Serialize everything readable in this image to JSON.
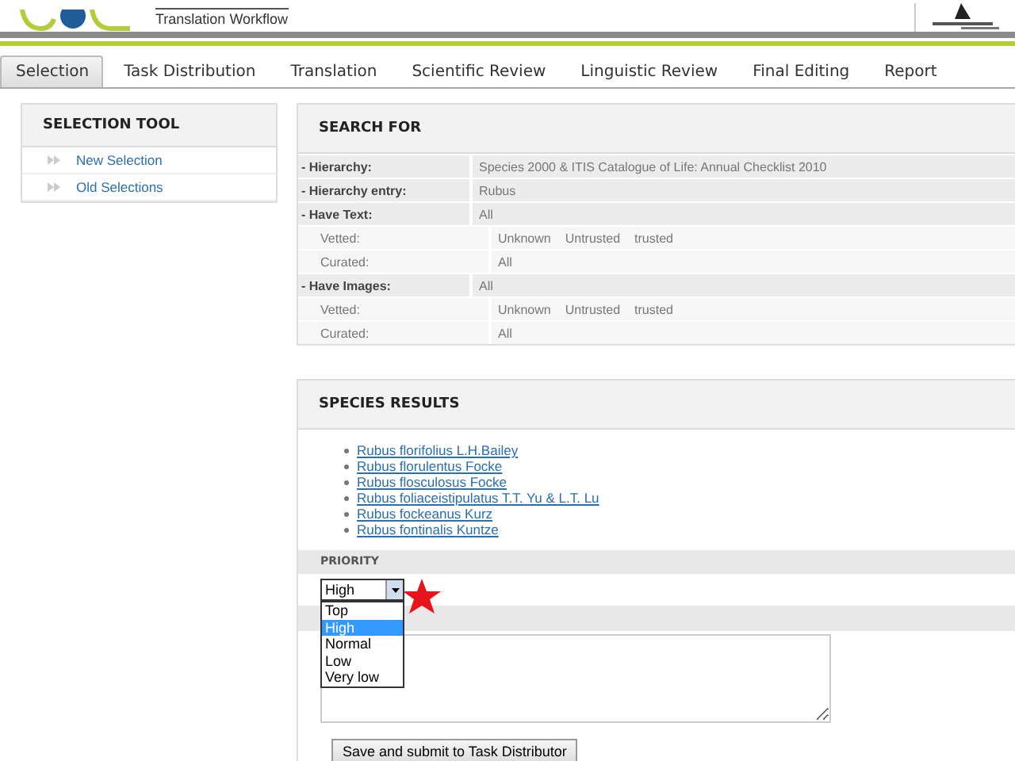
{
  "header": {
    "subtitle": "Translation Workflow"
  },
  "tabs": [
    {
      "label": "Selection",
      "selected": true
    },
    {
      "label": "Task Distribution",
      "selected": false
    },
    {
      "label": "Translation",
      "selected": false
    },
    {
      "label": "Scientific Review",
      "selected": false
    },
    {
      "label": "Linguistic Review",
      "selected": false
    },
    {
      "label": "Final Editing",
      "selected": false
    },
    {
      "label": "Report",
      "selected": false
    }
  ],
  "sidebar": {
    "title": "SELECTION TOOL",
    "items": [
      {
        "label": "New Selection"
      },
      {
        "label": "Old Selections"
      }
    ]
  },
  "search": {
    "title": "SEARCH FOR",
    "rows": [
      {
        "kind": "main",
        "label": "- Hierarchy:",
        "values": [
          "Species 2000 & ITIS Catalogue of Life: Annual Checklist 2010"
        ]
      },
      {
        "kind": "main",
        "label": "- Hierarchy entry:",
        "values": [
          "Rubus"
        ]
      },
      {
        "kind": "main",
        "label": "- Have Text:",
        "values": [
          "All"
        ]
      },
      {
        "kind": "sub",
        "label": "Vetted:",
        "values": [
          "Unknown",
          "Untrusted",
          "trusted"
        ]
      },
      {
        "kind": "sub",
        "label": "Curated:",
        "values": [
          "All"
        ]
      },
      {
        "kind": "main",
        "label": "- Have Images:",
        "values": [
          "All"
        ]
      },
      {
        "kind": "sub",
        "label": "Vetted:",
        "values": [
          "Unknown",
          "Untrusted",
          "trusted"
        ]
      },
      {
        "kind": "sub",
        "label": "Curated:",
        "values": [
          "All"
        ]
      }
    ]
  },
  "results": {
    "title": "SPECIES RESULTS",
    "species": [
      "Rubus florifolius L.H.Bailey",
      "Rubus florulentus Focke",
      "Rubus flosculosus Focke",
      "Rubus foliaceistipulatus T.T. Yu & L.T. Lu",
      "Rubus fockeanus Kurz",
      "Rubus fontinalis Kuntze"
    ],
    "priority": {
      "label": "PRIORITY",
      "value": "High",
      "expanded": true,
      "options": [
        {
          "label": "Top",
          "selected": false
        },
        {
          "label": "High",
          "selected": true
        },
        {
          "label": "Normal",
          "selected": false
        },
        {
          "label": "Low",
          "selected": false
        },
        {
          "label": "Very low",
          "selected": false
        }
      ]
    },
    "submit": "Save and submit to Task Distributor"
  }
}
